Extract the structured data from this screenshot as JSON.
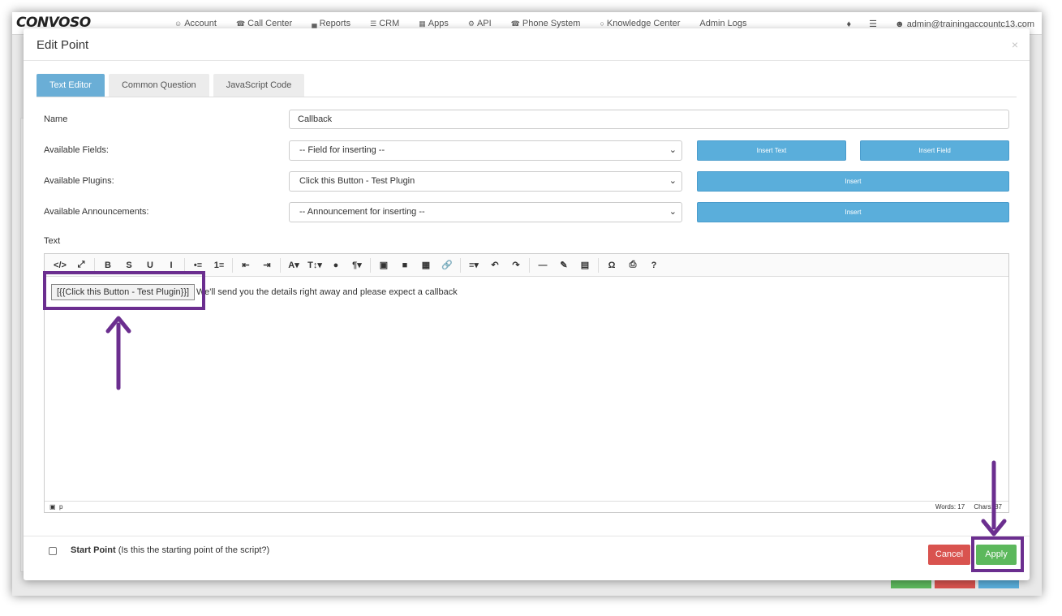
{
  "app": {
    "logo": "CONVOSO",
    "nav": [
      {
        "icon": "user-icon",
        "glyph": "☺",
        "label": "Account"
      },
      {
        "icon": "phone-icon",
        "glyph": "☎",
        "label": "Call Center"
      },
      {
        "icon": "bar-chart-icon",
        "glyph": "▄",
        "label": "Reports"
      },
      {
        "icon": "list-icon",
        "glyph": "☰",
        "label": "CRM"
      },
      {
        "icon": "grid-icon",
        "glyph": "▦",
        "label": "Apps"
      },
      {
        "icon": "gear-icon",
        "glyph": "⚙",
        "label": "API"
      },
      {
        "icon": "phone-icon",
        "glyph": "☎",
        "label": "Phone System"
      },
      {
        "icon": "lightbulb-icon",
        "glyph": "○",
        "label": "Knowledge Center"
      },
      {
        "icon": "",
        "glyph": "",
        "label": "Admin Logs"
      }
    ],
    "user_email": "admin@trainingaccountc13.com"
  },
  "modal": {
    "title": "Edit Point",
    "close": "×",
    "tabs": [
      "Text Editor",
      "Common Question",
      "JavaScript Code"
    ],
    "active_tab": "Text Editor",
    "fields": {
      "name_label": "Name",
      "name_value": "Callback",
      "fields_label": "Available Fields:",
      "fields_value": "-- Field for inserting --",
      "insert_text": "Insert Text",
      "insert_field": "Insert Field",
      "plugins_label": "Available Plugins:",
      "plugins_value": "Click this Button - Test Plugin",
      "plugins_insert": "Insert",
      "announce_label": "Available Announcements:",
      "announce_value": "-- Announcement for inserting --",
      "announce_insert": "Insert"
    },
    "text_label": "Text",
    "editor": {
      "toolbar": [
        "</>",
        "⤢",
        "B",
        "S",
        "U",
        "I",
        "•≡",
        "1≡",
        "⇤",
        "⇥",
        "A▾",
        "T↕▾",
        "●",
        "¶▾",
        "▣",
        "■",
        "▦",
        "🔗",
        "≡▾",
        "↶",
        "↷",
        "—",
        "✎",
        "▤",
        "Ω",
        "⎙",
        "?"
      ],
      "plugin_tag": "[{{Click this Button - Test Plugin}}]",
      "content_text": "We'll send you the details right away and please expect a callback",
      "status_path": "p",
      "words": "Words: 17",
      "chars": "Chars: 87"
    },
    "footer": {
      "start_point": "Start Point",
      "start_point_hint": "(Is this the starting point of the script?)",
      "cancel": "Cancel",
      "apply": "Apply"
    }
  },
  "colors": {
    "annotation": "#6b2e8f",
    "tab_active": "#6aaed6",
    "btn_blue": "#5aaedb",
    "cancel": "#d9534f",
    "apply": "#5cb85c"
  }
}
